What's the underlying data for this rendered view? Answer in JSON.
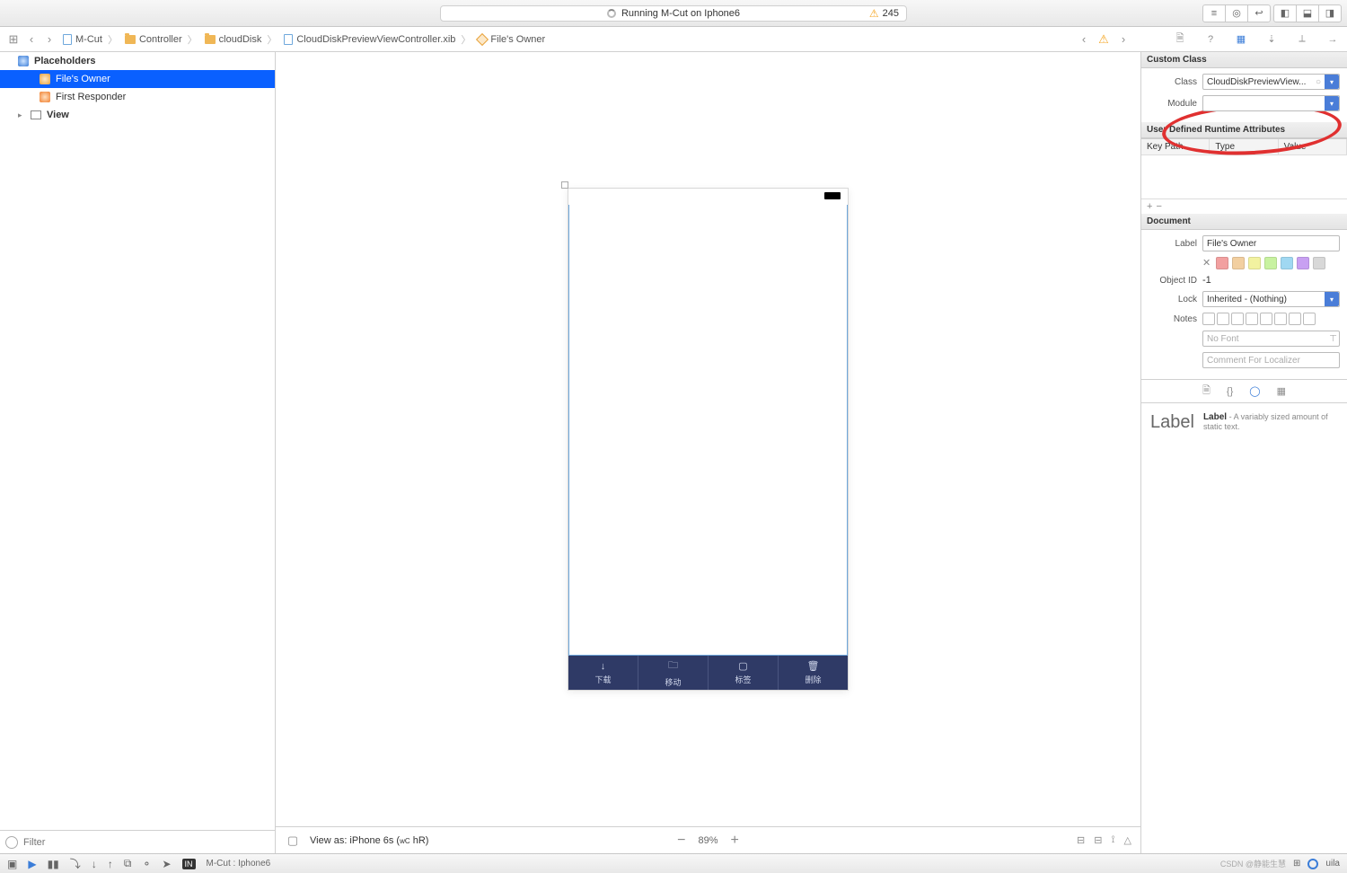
{
  "titlebar": {
    "status_text": "Running M-Cut on Iphone6",
    "warning_count": "245"
  },
  "breadcrumbs": [
    {
      "icon": "proj",
      "label": "M-Cut"
    },
    {
      "icon": "folder",
      "label": "Controller"
    },
    {
      "icon": "folder",
      "label": "cloudDisk"
    },
    {
      "icon": "file",
      "label": "CloudDiskPreviewViewController.xib"
    },
    {
      "icon": "cube",
      "label": "File's Owner"
    }
  ],
  "navigator": {
    "placeholders_label": "Placeholders",
    "files_owner": "File's Owner",
    "first_responder": "First Responder",
    "view_label": "View",
    "filter_placeholder": "Filter"
  },
  "device": {
    "buttons": [
      {
        "icon": "↓",
        "label": "下载"
      },
      {
        "icon": "🗀",
        "label": "移动"
      },
      {
        "icon": "▢",
        "label": "标签"
      },
      {
        "icon": "🗑",
        "label": "删除"
      }
    ]
  },
  "canvas_footer": {
    "view_as": "View as: iPhone 6s (",
    "wc": "wC",
    "hr": " hR)",
    "zoom": "89%"
  },
  "inspector": {
    "custom_class_header": "Custom Class",
    "class_label": "Class",
    "class_value": "CloudDiskPreviewView...",
    "module_label": "Module",
    "module_value": "",
    "udra_header": "User Defined Runtime Attributes",
    "col_keypath": "Key Path",
    "col_type": "Type",
    "col_value": "Value",
    "document_header": "Document",
    "label_label": "Label",
    "label_value": "File's Owner",
    "objectid_label": "Object ID",
    "objectid_value": "-1",
    "lock_label": "Lock",
    "lock_value": "Inherited - (Nothing)",
    "notes_label": "Notes",
    "nofont": "No Font",
    "comment_placeholder": "Comment For Localizer",
    "swatch_colors": [
      "#f2a0a0",
      "#f2cfa0",
      "#f2f2a0",
      "#c8f2a0",
      "#a0d8f2",
      "#c8a0f2",
      "#d8d8d8"
    ]
  },
  "library": {
    "title": "Label",
    "item_title": "Label",
    "item_desc": " - A variably sized amount of static text."
  },
  "debugbar": {
    "target": "M-Cut : Iphone6",
    "right_text": "uila"
  },
  "watermark": "CSDN @静能生慧"
}
